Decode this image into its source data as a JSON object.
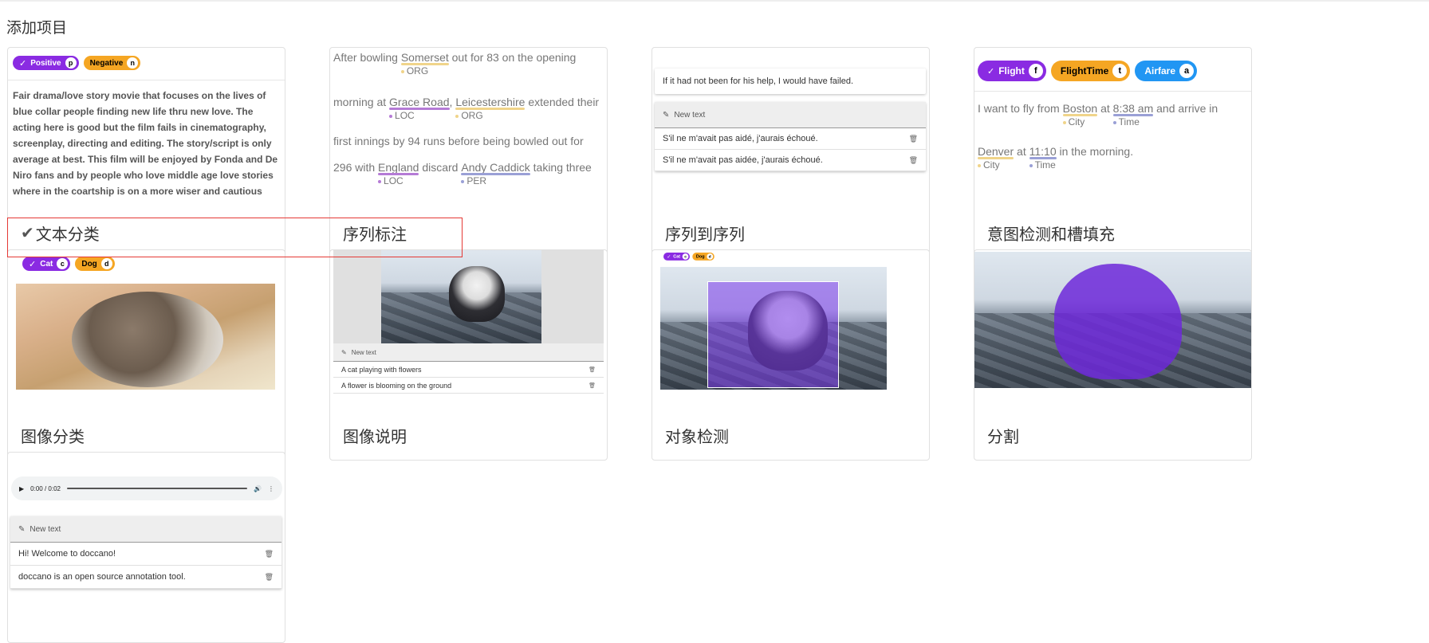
{
  "page": {
    "title": "添加项目"
  },
  "cards": {
    "text_classification": {
      "label": "文本分类",
      "selected": true,
      "chips": [
        {
          "label": "Positive",
          "key": "p",
          "color": "#8a2be2"
        },
        {
          "label": "Negative",
          "key": "n",
          "color": "#f5a623"
        }
      ],
      "text": "Fair drama/love story movie that focuses on the lives of blue collar people finding new life thru new love. The acting here is good but the film fails in cinematography, screenplay, directing and editing. The story/script is only average at best. This film will be enjoyed by Fonda and De Niro fans and by people who love middle age love stories where in the coartship is on a more wiser and cautious"
    },
    "sequence_labeling": {
      "label": "序列标注",
      "lines": [
        {
          "pre": "After bowling ",
          "e1": "Somerset",
          "t1": "ORG",
          "post": " out for 83 on the opening"
        },
        {
          "pre": "morning at ",
          "e1": "Grace Road",
          "t1": "LOC",
          "mid": ", ",
          "e2": "Leicestershire",
          "t2": "ORG",
          "post": " extended their"
        },
        {
          "pre": "first innings by 94 runs before being bowled out for"
        },
        {
          "pre": "296 with ",
          "e1": "England",
          "t1": "LOC",
          "mid": " discard ",
          "e2": "Andy Caddick",
          "t2": "PER",
          "post": " taking three"
        }
      ]
    },
    "seq2seq": {
      "label": "序列到序列",
      "source": "If it had not been for his help, I would have failed.",
      "header": "New text",
      "rows": [
        "S'il ne m'avait pas aidé, j'aurais échoué.",
        "S'il ne m'avait pas aidée, j'aurais échoué."
      ]
    },
    "intent": {
      "label": "意图检测和槽填充",
      "chips": [
        {
          "label": "Flight",
          "key": "f",
          "color": "#8a2be2"
        },
        {
          "label": "FlightTime",
          "key": "t",
          "color": "#f5a623"
        },
        {
          "label": "Airfare",
          "key": "a",
          "color": "#2196f3"
        }
      ],
      "line1": {
        "pre": "I want to fly from ",
        "e1": "Boston",
        "t1": "City",
        "mid": " at ",
        "e2": "8:38 am",
        "t2": "Time",
        "post": " and arrive in"
      },
      "line2": {
        "e1": "Denver",
        "t1": "City",
        "mid": " at ",
        "e2": "11:10",
        "t2": "Time",
        "post": " in the morning."
      }
    },
    "image_classification": {
      "label": "图像分类",
      "chips": [
        {
          "label": "Cat",
          "key": "c",
          "color": "#8a2be2"
        },
        {
          "label": "Dog",
          "key": "d",
          "color": "#f5a623"
        }
      ]
    },
    "image_caption": {
      "label": "图像说明",
      "header": "New text",
      "rows": [
        "A cat playing with flowers",
        "A flower is blooming on the ground"
      ]
    },
    "object_detection": {
      "label": "对象检测",
      "chips": [
        {
          "label": "Cat",
          "key": "c",
          "color": "#8a2be2"
        },
        {
          "label": "Dog",
          "key": "d",
          "color": "#f5a623"
        }
      ]
    },
    "segmentation": {
      "label": "分割"
    },
    "speech": {
      "time": "0:00 / 0:02",
      "header": "New text",
      "rows": [
        "Hi! Welcome to doccano!",
        "doccano is an open source annotation tool."
      ]
    }
  },
  "colors": {
    "purple": "#8a2be2",
    "orange": "#f5a623",
    "blue": "#2196f3",
    "loc_underline": "#b57bd6",
    "org_underline": "#f0d48a",
    "per_underline": "#9aa0d6",
    "selection_border": "#e53935"
  }
}
